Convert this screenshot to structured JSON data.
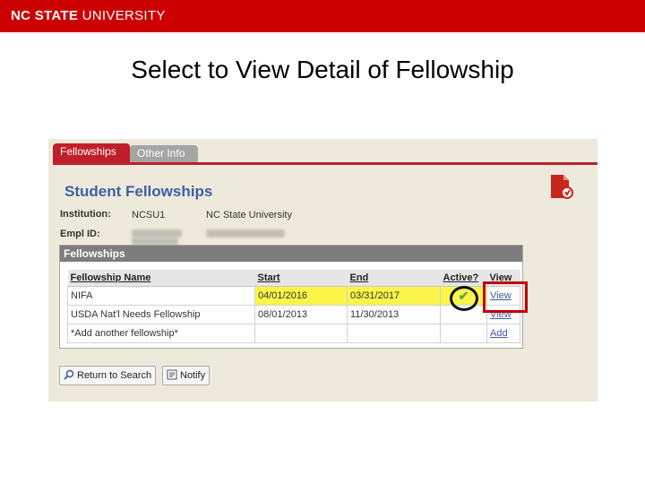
{
  "header": {
    "brand_bold": "NC STATE",
    "brand_rest": " UNIVERSITY"
  },
  "slide_title": "Select to View Detail of Fellowship",
  "tabs": [
    {
      "label": "Fellowships",
      "active": true
    },
    {
      "label": "Other Info",
      "active": false
    }
  ],
  "page_heading": "Student Fellowships",
  "fields": {
    "institution_label": "Institution:",
    "institution_code": "NCSU1",
    "institution_name": "NC State University",
    "emplid_label": "Empl ID:"
  },
  "grid": {
    "title": "Fellowships",
    "columns": [
      "Fellowship Name",
      "Start",
      "End",
      "Active?",
      "View"
    ],
    "rows": [
      {
        "name": "NIFA",
        "start": "04/01/2016",
        "end": "03/31/2017",
        "active": true,
        "link": "View",
        "highlight": true
      },
      {
        "name": "USDA Nat'l Needs Fellowship",
        "start": "08/01/2013",
        "end": "11/30/2013",
        "active": false,
        "link": "View",
        "highlight": false
      },
      {
        "name": "*Add another fellowship*",
        "start": "",
        "end": "",
        "active": false,
        "link": "Add",
        "highlight": false
      }
    ]
  },
  "buttons": {
    "return": "Return to Search",
    "notify": "Notify"
  },
  "colors": {
    "brand_red": "#cc0000",
    "tab_red": "#c01f2a",
    "heading_blue": "#3f5ea6",
    "highlight_yellow": "#fbf54a",
    "link_blue": "#3e5b9e"
  },
  "icons": {
    "active_check": "✔",
    "pdf": "pdf-icon",
    "search": "search-icon",
    "notify": "notify-icon"
  }
}
